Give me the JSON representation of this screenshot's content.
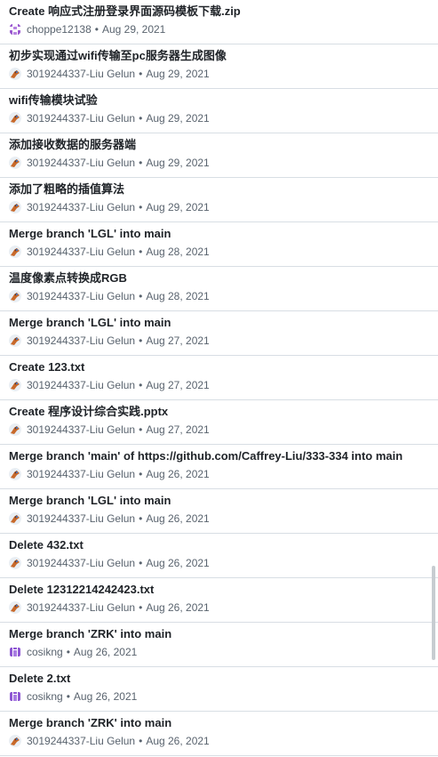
{
  "colors": {
    "title_text": "#1f2328",
    "meta_text": "#59636e",
    "divider": "#d8dee4"
  },
  "commits": [
    {
      "message": "Create 响应式注册登录界面源码模板下载.zip",
      "author": "choppe12138",
      "date": "Aug 29, 2021",
      "avatar_icon": "purple-pixel-avatar"
    },
    {
      "message": "初步实现通过wifi传输至pc服务器生成图像",
      "author": "3019244337-Liu Gelun",
      "date": "Aug 29, 2021",
      "avatar_icon": "fox-avatar"
    },
    {
      "message": "wifi传输模块试验",
      "author": "3019244337-Liu Gelun",
      "date": "Aug 29, 2021",
      "avatar_icon": "fox-avatar"
    },
    {
      "message": "添加接收数据的服务器端",
      "author": "3019244337-Liu Gelun",
      "date": "Aug 29, 2021",
      "avatar_icon": "fox-avatar"
    },
    {
      "message": "添加了粗略的插值算法",
      "author": "3019244337-Liu Gelun",
      "date": "Aug 29, 2021",
      "avatar_icon": "fox-avatar"
    },
    {
      "message": "Merge branch 'LGL' into main",
      "author": "3019244337-Liu Gelun",
      "date": "Aug 28, 2021",
      "avatar_icon": "fox-avatar"
    },
    {
      "message": "温度像素点转换成RGB",
      "author": "3019244337-Liu Gelun",
      "date": "Aug 28, 2021",
      "avatar_icon": "fox-avatar"
    },
    {
      "message": "Merge branch 'LGL' into main",
      "author": "3019244337-Liu Gelun",
      "date": "Aug 27, 2021",
      "avatar_icon": "fox-avatar"
    },
    {
      "message": "Create 123.txt",
      "author": "3019244337-Liu Gelun",
      "date": "Aug 27, 2021",
      "avatar_icon": "fox-avatar"
    },
    {
      "message": "Create 程序设计综合实践.pptx",
      "author": "3019244337-Liu Gelun",
      "date": "Aug 27, 2021",
      "avatar_icon": "fox-avatar"
    },
    {
      "message": "Merge branch 'main' of https://github.com/Caffrey-Liu/333-334 into main",
      "author": "3019244337-Liu Gelun",
      "date": "Aug 26, 2021",
      "avatar_icon": "fox-avatar"
    },
    {
      "message": "Merge branch 'LGL' into main",
      "author": "3019244337-Liu Gelun",
      "date": "Aug 26, 2021",
      "avatar_icon": "fox-avatar"
    },
    {
      "message": "Delete 432.txt",
      "author": "3019244337-Liu Gelun",
      "date": "Aug 26, 2021",
      "avatar_icon": "fox-avatar"
    },
    {
      "message": "Delete 12312214242423.txt",
      "author": "3019244337-Liu Gelun",
      "date": "Aug 26, 2021",
      "avatar_icon": "fox-avatar"
    },
    {
      "message": "Merge branch 'ZRK' into main",
      "author": "cosikng",
      "date": "Aug 26, 2021",
      "avatar_icon": "purple-identicon-avatar"
    },
    {
      "message": "Delete 2.txt",
      "author": "cosikng",
      "date": "Aug 26, 2021",
      "avatar_icon": "purple-identicon-avatar"
    },
    {
      "message": "Merge branch 'ZRK' into main",
      "author": "3019244337-Liu Gelun",
      "date": "Aug 26, 2021",
      "avatar_icon": "fox-avatar"
    }
  ],
  "separator": "•"
}
